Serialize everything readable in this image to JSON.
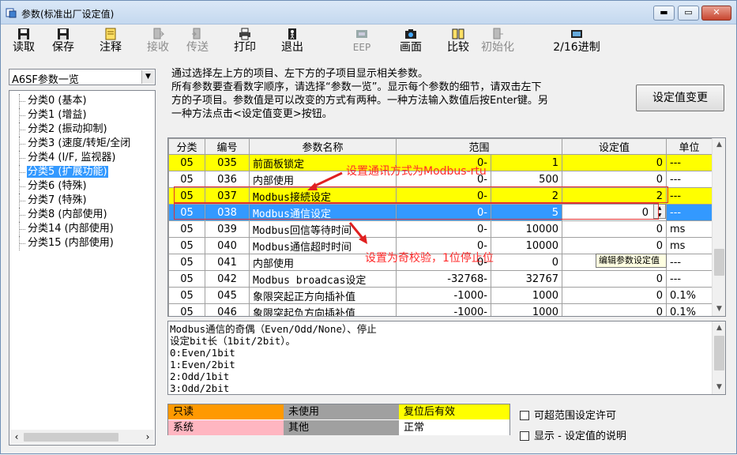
{
  "window": {
    "title": "参数(标准出厂设定值)",
    "controls": {
      "minimize": "▬",
      "maximize": "▭",
      "close": "✕"
    }
  },
  "toolbar": {
    "buttons": [
      {
        "label": "读取",
        "icon": "floppy-read-icon",
        "enabled": true
      },
      {
        "label": "保存",
        "icon": "floppy-save-icon",
        "enabled": true
      },
      {
        "label": "注释",
        "icon": "note-icon",
        "enabled": true
      },
      {
        "label": "接收",
        "icon": "receive-icon",
        "enabled": false
      },
      {
        "label": "传送",
        "icon": "send-icon",
        "enabled": false
      },
      {
        "label": "打印",
        "icon": "printer-icon",
        "enabled": true
      },
      {
        "label": "退出",
        "icon": "exit-icon",
        "enabled": true
      },
      {
        "label": "EEP",
        "icon": "eep-icon",
        "enabled": false
      },
      {
        "label": "画面",
        "icon": "camera-icon",
        "enabled": true
      },
      {
        "label": "比较",
        "icon": "compare-icon",
        "enabled": true
      },
      {
        "label": "初始化",
        "icon": "initialize-icon",
        "enabled": false
      },
      {
        "label": "2/16进制",
        "icon": "hex-icon",
        "enabled": true
      }
    ]
  },
  "sidebar": {
    "combo_value": "A6SF参数一览",
    "tree_items": [
      "分类0 (基本)",
      "分类1 (增益)",
      "分类2 (振动抑制)",
      "分类3 (速度/转矩/全闭",
      "分类4 (I/F, 监视器)",
      "分类5 (扩展功能)",
      "分类6 (特殊)",
      "分类7 (特殊)",
      "分类8 (内部使用)",
      "分类14 (内部使用)",
      "分类15 (内部使用)"
    ],
    "selected_index": 5
  },
  "info": {
    "lines": [
      "通过选择左上方的项目、左下方的子项目显示相关参数。",
      "所有参数要查看数字顺序，请选择“参数一览”。显示每个参数的细节，请双击左下",
      "方的子项目。参数值是可以改变的方式有两种。一种方法输入数值后按Enter键。另",
      "一种方法点击<设定值变更>按钮。"
    ]
  },
  "set_button": "设定值变更",
  "grid": {
    "headers": [
      "分类",
      "编号",
      "参数名称",
      "范围",
      "设定值",
      "单位"
    ],
    "rows": [
      {
        "cls": "05",
        "no": "035",
        "name": "前面板锁定",
        "min": "0-",
        "max": "1",
        "value": "0",
        "unit": "---",
        "highlight": "yellow"
      },
      {
        "cls": "05",
        "no": "036",
        "name": "内部使用",
        "min": "0-",
        "max": "500",
        "value": "0",
        "unit": "---",
        "highlight": "none"
      },
      {
        "cls": "05",
        "no": "037",
        "name": "Modbus接続设定",
        "min": "0-",
        "max": "2",
        "value": "2",
        "unit": "---",
        "highlight": "yellow"
      },
      {
        "cls": "05",
        "no": "038",
        "name": "Modbus通信设定",
        "min": "0-",
        "max": "5",
        "value": "0",
        "unit": "---",
        "highlight": "blue"
      },
      {
        "cls": "05",
        "no": "039",
        "name": "Modbus回信等待时间",
        "min": "0-",
        "max": "10000",
        "value": "0",
        "unit": "ms",
        "highlight": "none"
      },
      {
        "cls": "05",
        "no": "040",
        "name": "Modbus通信超时时间",
        "min": "0-",
        "max": "10000",
        "value": "0",
        "unit": "ms",
        "highlight": "none"
      },
      {
        "cls": "05",
        "no": "041",
        "name": "内部使用",
        "min": "0-",
        "max": "0",
        "value": "0",
        "unit": "---",
        "highlight": "none"
      },
      {
        "cls": "05",
        "no": "042",
        "name": "Modbus broadcas设定",
        "min": "-32768-",
        "max": "32767",
        "value": "0",
        "unit": "---",
        "highlight": "none"
      },
      {
        "cls": "05",
        "no": "045",
        "name": "象限突起正方向插补值",
        "min": "-1000-",
        "max": "1000",
        "value": "0",
        "unit": "0.1%",
        "highlight": "none"
      },
      {
        "cls": "05",
        "no": "046",
        "name": "象限突起负方向插补值",
        "min": "-1000-",
        "max": "1000",
        "value": "0",
        "unit": "0.1%",
        "highlight": "none"
      }
    ]
  },
  "annotations": {
    "top": "设置通讯方式为Modbus-rtu",
    "bottom": "设置为奇校验，1位停止位"
  },
  "tooltip": "编辑参数设定值",
  "description": {
    "lines": [
      "Modbus通信的奇偶（Even/Odd/None）、停止",
      "设定bit长（1bit/2bit）。",
      "0:Even/1bit",
      "1:Even/2bit",
      "2:Odd/1bit",
      "3:Odd/2bit"
    ]
  },
  "legend": {
    "cells": [
      {
        "label": "只读",
        "color": "#ff9900"
      },
      {
        "label": "未使用",
        "color": "#a0a0a0"
      },
      {
        "label": "复位后有效",
        "color": "#ffff00"
      },
      {
        "label": "系统",
        "color": "#ffb6c1"
      },
      {
        "label": "其他",
        "color": "#a0a0a0"
      },
      {
        "label": "正常",
        "color": "#ffffff"
      }
    ]
  },
  "checkboxes": [
    {
      "label": "可超范围设定许可",
      "checked": false
    },
    {
      "label": "显示 - 设定值的说明",
      "checked": false
    }
  ],
  "colors": {
    "selection": "#3399ff",
    "reset_effective": "#ffff00",
    "annotation": "#ff2a2a"
  }
}
